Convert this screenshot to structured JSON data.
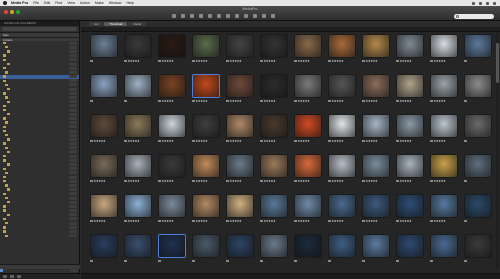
{
  "menubar": {
    "items": [
      "Media Pro",
      "File",
      "Edit",
      "Find",
      "View",
      "Action",
      "Make",
      "Window",
      "Help"
    ]
  },
  "window": {
    "title": "MediaPro"
  },
  "sidebar": {
    "header": "CATALOG FOLDERS",
    "sections": [
      {
        "label": "Sets"
      },
      {
        "label": "Folders"
      }
    ],
    "rows": [
      {
        "label": "",
        "icon": "folder",
        "count": "",
        "selected": false
      },
      {
        "label": "",
        "icon": "folder",
        "count": "",
        "selected": false
      },
      {
        "label": "",
        "icon": "folder",
        "count": "",
        "selected": false
      },
      {
        "label": "",
        "icon": "folder",
        "count": "",
        "selected": false
      },
      {
        "label": "",
        "icon": "folder",
        "count": "",
        "selected": false
      },
      {
        "label": "",
        "icon": "folder",
        "count": "",
        "selected": false
      },
      {
        "label": "",
        "icon": "folder",
        "count": "",
        "selected": false
      },
      {
        "label": "",
        "icon": "folder",
        "count": "",
        "selected": false
      },
      {
        "label": "",
        "icon": "folder",
        "count": "",
        "selected": true
      },
      {
        "label": "",
        "icon": "folder",
        "count": "",
        "selected": false
      },
      {
        "label": "",
        "icon": "folder",
        "count": "",
        "selected": false
      },
      {
        "label": "",
        "icon": "folder",
        "count": "",
        "selected": false
      },
      {
        "label": "",
        "icon": "folder",
        "count": "",
        "selected": false
      },
      {
        "label": "",
        "icon": "folder",
        "count": "",
        "selected": false
      },
      {
        "label": "",
        "icon": "folder",
        "count": "",
        "selected": false
      },
      {
        "label": "",
        "icon": "folder",
        "count": "",
        "selected": false
      },
      {
        "label": "",
        "icon": "folder",
        "count": "",
        "selected": false
      },
      {
        "label": "",
        "icon": "folder",
        "count": "",
        "selected": false
      },
      {
        "label": "",
        "icon": "folder",
        "count": "",
        "selected": false
      },
      {
        "label": "",
        "icon": "folder",
        "count": "",
        "selected": false
      },
      {
        "label": "",
        "icon": "folder",
        "count": "",
        "selected": false
      },
      {
        "label": "",
        "icon": "folder",
        "count": "",
        "selected": false
      },
      {
        "label": "",
        "icon": "folder",
        "count": "",
        "selected": false
      },
      {
        "label": "",
        "icon": "folder",
        "count": "",
        "selected": false
      },
      {
        "label": "",
        "icon": "folder",
        "count": "",
        "selected": false
      },
      {
        "label": "",
        "icon": "folder",
        "count": "",
        "selected": false
      },
      {
        "label": "",
        "icon": "folder",
        "count": "",
        "selected": false
      },
      {
        "label": "",
        "icon": "folder",
        "count": "",
        "selected": false
      },
      {
        "label": "",
        "icon": "folder",
        "count": "",
        "selected": false
      },
      {
        "label": "",
        "icon": "folder",
        "count": "",
        "selected": false
      },
      {
        "label": "",
        "icon": "folder",
        "count": "",
        "selected": false
      },
      {
        "label": "",
        "icon": "folder",
        "count": "",
        "selected": false
      },
      {
        "label": "",
        "icon": "folder",
        "count": "",
        "selected": false
      },
      {
        "label": "",
        "icon": "folder",
        "count": "",
        "selected": false
      },
      {
        "label": "",
        "icon": "folder",
        "count": "",
        "selected": false
      },
      {
        "label": "",
        "icon": "folder",
        "count": "",
        "selected": false
      },
      {
        "label": "",
        "icon": "folder",
        "count": "",
        "selected": false
      },
      {
        "label": "",
        "icon": "folder",
        "count": "",
        "selected": false
      },
      {
        "label": "",
        "icon": "folder",
        "count": "",
        "selected": false
      },
      {
        "label": "",
        "icon": "folder",
        "count": "",
        "selected": false
      },
      {
        "label": "",
        "icon": "folder",
        "count": "",
        "selected": false
      },
      {
        "label": "",
        "icon": "folder",
        "count": "",
        "selected": false
      },
      {
        "label": "",
        "icon": "folder",
        "count": "",
        "selected": false
      },
      {
        "label": "",
        "icon": "folder",
        "count": "",
        "selected": false
      },
      {
        "label": "",
        "icon": "folder",
        "count": "",
        "selected": false
      },
      {
        "label": "",
        "icon": "folder",
        "count": "",
        "selected": false
      },
      {
        "label": "",
        "icon": "folder",
        "count": "",
        "selected": false
      }
    ],
    "sub_header": "",
    "sub_rows": [
      {
        "label": "",
        "count": ""
      },
      {
        "label": "",
        "count": ""
      }
    ]
  },
  "main": {
    "view_tabs": [
      {
        "label": "List",
        "active": false
      },
      {
        "label": "Thumbnail",
        "active": true
      },
      {
        "label": "Media",
        "active": false
      }
    ],
    "path": "",
    "zoom": ""
  },
  "thumbnails": [
    {
      "color": "#6b7f95",
      "stars": "",
      "caption": "",
      "sel": false,
      "hl": false
    },
    {
      "color": "#3a3a3a",
      "stars": "★★★★★",
      "caption": "",
      "sel": false,
      "hl": false
    },
    {
      "color": "#2a1a14",
      "stars": "★★★★★",
      "caption": "",
      "sel": false,
      "hl": false
    },
    {
      "color": "#5a6b4a",
      "stars": "★★★★★",
      "caption": "",
      "sel": false,
      "hl": false
    },
    {
      "color": "#444444",
      "stars": "★★★★★",
      "caption": "",
      "sel": false,
      "hl": false
    },
    {
      "color": "#333333",
      "stars": "★★★★★",
      "caption": "",
      "sel": false,
      "hl": false
    },
    {
      "color": "#8a6a4a",
      "stars": "★★★★★",
      "caption": "",
      "sel": false,
      "hl": false
    },
    {
      "color": "#a96a3a",
      "stars": "★★★★★",
      "caption": "",
      "sel": false,
      "hl": false
    },
    {
      "color": "#b58a4a",
      "stars": "★★★★★",
      "caption": "",
      "sel": false,
      "hl": false
    },
    {
      "color": "#7f8a94",
      "stars": "★★★★★",
      "caption": "",
      "sel": false,
      "hl": false
    },
    {
      "color": "#d7dde2",
      "stars": "★★★★★",
      "caption": "",
      "sel": false,
      "hl": false
    },
    {
      "color": "#5c7a9c",
      "stars": "",
      "caption": "",
      "sel": false,
      "hl": false
    },
    {
      "color": "#8aa2c0",
      "stars": "",
      "caption": "",
      "sel": false,
      "hl": false
    },
    {
      "color": "#9fb0c4",
      "stars": "",
      "caption": "",
      "sel": false,
      "hl": false
    },
    {
      "color": "#7a4422",
      "stars": "★★★★★",
      "caption": "",
      "sel": false,
      "hl": false
    },
    {
      "color": "#c24a1c",
      "stars": "★★★★★",
      "caption": "",
      "sel": true,
      "hl": false
    },
    {
      "color": "#6f4a3a",
      "stars": "★★★★★",
      "caption": "",
      "sel": false,
      "hl": false
    },
    {
      "color": "#2c2c2c",
      "stars": "★★★★★",
      "caption": "",
      "sel": false,
      "hl": false
    },
    {
      "color": "#7a7a7a",
      "stars": "★★★★★",
      "caption": "",
      "sel": false,
      "hl": false
    },
    {
      "color": "#555555",
      "stars": "★★★★★",
      "caption": "",
      "sel": false,
      "hl": false
    },
    {
      "color": "#8a6d5a",
      "stars": "★★★★★",
      "caption": "",
      "sel": false,
      "hl": false
    },
    {
      "color": "#b0a28a",
      "stars": "★★★★★",
      "caption": "",
      "sel": false,
      "hl": false
    },
    {
      "color": "#9aa3a8",
      "stars": "★★★★★",
      "caption": "",
      "sel": false,
      "hl": false
    },
    {
      "color": "#8c8c8c",
      "stars": "",
      "caption": "",
      "sel": false,
      "hl": false
    },
    {
      "color": "#5e4a3a",
      "stars": "★★★★★",
      "caption": "",
      "sel": false,
      "hl": false
    },
    {
      "color": "#8a7a5a",
      "stars": "★★★★★",
      "caption": "",
      "sel": false,
      "hl": false
    },
    {
      "color": "#ccd4dc",
      "stars": "★★★★★",
      "caption": "",
      "sel": false,
      "hl": false
    },
    {
      "color": "#3e3e3e",
      "stars": "★★★★★",
      "caption": "",
      "sel": false,
      "hl": false
    },
    {
      "color": "#b08a6a",
      "stars": "★★★★★",
      "caption": "",
      "sel": false,
      "hl": false
    },
    {
      "color": "#4a3a2e",
      "stars": "★★★★★",
      "caption": "",
      "sel": false,
      "hl": false
    },
    {
      "color": "#d24a22",
      "stars": "★★★★★",
      "caption": "",
      "sel": false,
      "hl": false
    },
    {
      "color": "#e0e4e8",
      "stars": "★★★★★",
      "caption": "",
      "sel": false,
      "hl": false
    },
    {
      "color": "#a5b5c5",
      "stars": "★★★★★",
      "caption": "",
      "sel": false,
      "hl": false
    },
    {
      "color": "#8a9aa8",
      "stars": "★★★★★",
      "caption": "",
      "sel": false,
      "hl": false
    },
    {
      "color": "#bcc6cf",
      "stars": "★★★★★",
      "caption": "",
      "sel": false,
      "hl": false
    },
    {
      "color": "#6a6a6a",
      "stars": "",
      "caption": "",
      "sel": false,
      "hl": false
    },
    {
      "color": "#7a6a58",
      "stars": "★★★★★",
      "caption": "",
      "sel": false,
      "hl": false
    },
    {
      "color": "#a8b0b8",
      "stars": "★★★★★",
      "caption": "",
      "sel": false,
      "hl": false
    },
    {
      "color": "#3a3a3a",
      "stars": "★★★★★",
      "caption": "",
      "sel": false,
      "hl": true
    },
    {
      "color": "#c28a5a",
      "stars": "★★★★★",
      "caption": "",
      "sel": false,
      "hl": false
    },
    {
      "color": "#6a7a8a",
      "stars": "★★★★★",
      "caption": "",
      "sel": false,
      "hl": false
    },
    {
      "color": "#9a7a5a",
      "stars": "★★★★★",
      "caption": "",
      "sel": false,
      "hl": false
    },
    {
      "color": "#d86a3a",
      "stars": "★★★★★",
      "caption": "",
      "sel": false,
      "hl": false
    },
    {
      "color": "#b6bec6",
      "stars": "★★★★★",
      "caption": "",
      "sel": false,
      "hl": false
    },
    {
      "color": "#7b8d9c",
      "stars": "★★★★★",
      "caption": "",
      "sel": false,
      "hl": false
    },
    {
      "color": "#a7b3bd",
      "stars": "★★★★★",
      "caption": "",
      "sel": false,
      "hl": false
    },
    {
      "color": "#c9a24a",
      "stars": "★★★★★",
      "caption": "",
      "sel": false,
      "hl": false
    },
    {
      "color": "#5e6e7e",
      "stars": "",
      "caption": "",
      "sel": false,
      "hl": false
    },
    {
      "color": "#c9a880",
      "stars": "★★★★★",
      "caption": "",
      "sel": false,
      "hl": false
    },
    {
      "color": "#8cb0d4",
      "stars": "★★★★★",
      "caption": "",
      "sel": false,
      "hl": false
    },
    {
      "color": "#7a8a9a",
      "stars": "★★★★★",
      "caption": "",
      "sel": false,
      "hl": false
    },
    {
      "color": "#b48a64",
      "stars": "★★★★★",
      "caption": "",
      "sel": false,
      "hl": false
    },
    {
      "color": "#d0b080",
      "stars": "★★★★★",
      "caption": "",
      "sel": false,
      "hl": false
    },
    {
      "color": "#5a7a9a",
      "stars": "★★★★★",
      "caption": "",
      "sel": false,
      "hl": false
    },
    {
      "color": "#6f8aa8",
      "stars": "★★★★★",
      "caption": "",
      "sel": false,
      "hl": false
    },
    {
      "color": "#4a6a8e",
      "stars": "★★★★★",
      "caption": "",
      "sel": false,
      "hl": false
    },
    {
      "color": "#3c5a7c",
      "stars": "★★★★★",
      "caption": "",
      "sel": false,
      "hl": false
    },
    {
      "color": "#2d4e76",
      "stars": "★★★★★",
      "caption": "",
      "sel": false,
      "hl": false
    },
    {
      "color": "#557a9e",
      "stars": "★★★★★",
      "caption": "",
      "sel": false,
      "hl": false
    },
    {
      "color": "#2a4a6a",
      "stars": "",
      "caption": "",
      "sel": false,
      "hl": false
    },
    {
      "color": "#2a3e5e",
      "stars": "",
      "caption": "",
      "sel": false,
      "hl": false
    },
    {
      "color": "#3a4e6e",
      "stars": "",
      "caption": "",
      "sel": false,
      "hl": false
    },
    {
      "color": "#1e3050",
      "stars": "",
      "caption": "",
      "sel": true,
      "hl": false
    },
    {
      "color": "#4a5a6a",
      "stars": "",
      "caption": "",
      "sel": false,
      "hl": false
    },
    {
      "color": "#2c4464",
      "stars": "",
      "caption": "",
      "sel": false,
      "hl": false
    },
    {
      "color": "#6a7a8a",
      "stars": "",
      "caption": "",
      "sel": false,
      "hl": false
    },
    {
      "color": "#1a2a3a",
      "stars": "",
      "caption": "",
      "sel": false,
      "hl": false
    },
    {
      "color": "#3d5e82",
      "stars": "",
      "caption": "",
      "sel": false,
      "hl": false
    },
    {
      "color": "#5a7aa0",
      "stars": "",
      "caption": "",
      "sel": false,
      "hl": false
    },
    {
      "color": "#2e4a70",
      "stars": "",
      "caption": "",
      "sel": false,
      "hl": false
    },
    {
      "color": "#4a6a92",
      "stars": "",
      "caption": "",
      "sel": false,
      "hl": false
    },
    {
      "color": "#3a3a3a",
      "stars": "",
      "caption": "",
      "sel": false,
      "hl": false
    }
  ],
  "statusbar": {
    "left": "",
    "right": ""
  }
}
